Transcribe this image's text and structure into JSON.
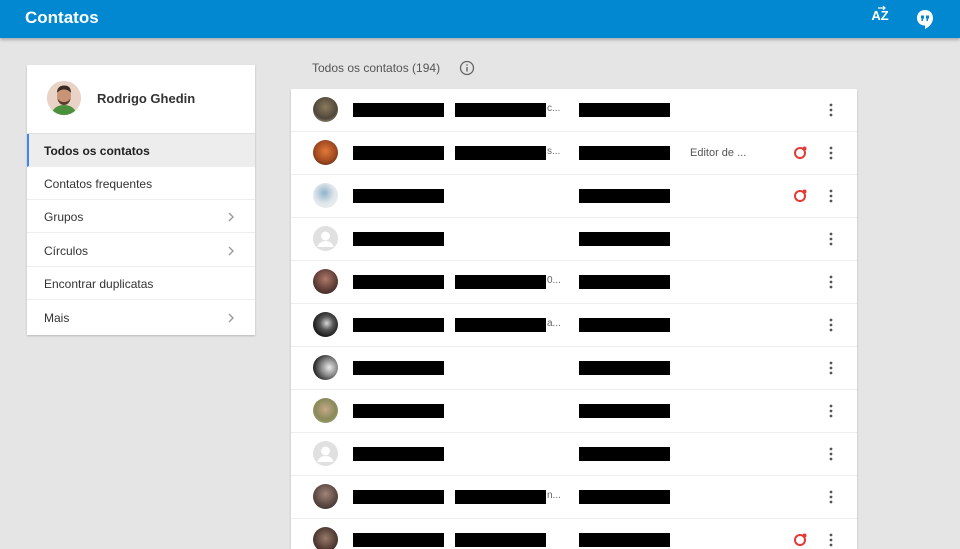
{
  "app": {
    "title": "Contatos",
    "sort_label": "AZ"
  },
  "colors": {
    "accent": "#0288d1",
    "active_border": "#4285f4",
    "circles_red": "#e53935"
  },
  "sidebar": {
    "profile_name": "Rodrigo Ghedin",
    "items": [
      {
        "label": "Todos os contatos",
        "active": true,
        "chevron": false
      },
      {
        "label": "Contatos frequentes",
        "active": false,
        "chevron": false
      },
      {
        "label": "Grupos",
        "active": false,
        "chevron": true
      },
      {
        "label": "Círculos",
        "active": false,
        "chevron": true
      },
      {
        "label": "Encontrar duplicatas",
        "active": false,
        "chevron": false
      },
      {
        "label": "Mais",
        "active": false,
        "chevron": true
      }
    ]
  },
  "list": {
    "header": "Todos os contatos (194)",
    "rows": [
      {
        "avatar": "photo-1",
        "email_trail": "c...",
        "job": "",
        "circle": false
      },
      {
        "avatar": "photo-2",
        "email_trail": "s...",
        "job": "Editor de ...",
        "circle": true
      },
      {
        "avatar": "photo-3",
        "email_trail": "",
        "job": "",
        "circle": true
      },
      {
        "avatar": "default",
        "email_trail": "",
        "job": "",
        "circle": false
      },
      {
        "avatar": "photo-5",
        "email_trail": "0...",
        "job": "",
        "circle": false
      },
      {
        "avatar": "photo-6",
        "email_trail": "a...",
        "job": "",
        "circle": false
      },
      {
        "avatar": "photo-7",
        "email_trail": "",
        "job": "",
        "circle": false
      },
      {
        "avatar": "photo-8",
        "email_trail": "",
        "job": "",
        "circle": false
      },
      {
        "avatar": "default",
        "email_trail": "",
        "job": "",
        "circle": false
      },
      {
        "avatar": "photo-10",
        "email_trail": "n...",
        "job": "",
        "circle": false
      },
      {
        "avatar": "photo-11",
        "email_trail": "",
        "job": "",
        "circle": true
      }
    ]
  },
  "icons": {
    "sort": "sort-az-icon",
    "hangouts": "hangouts-icon",
    "info": "info-icon",
    "more": "more-vert-icon",
    "circles": "google-circles-icon",
    "chevron": "chevron-right-icon"
  }
}
